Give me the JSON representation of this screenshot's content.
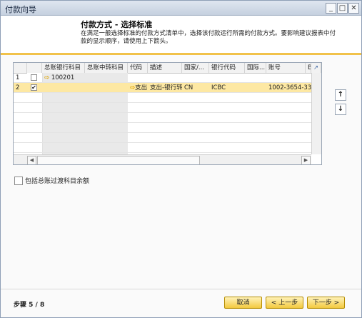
{
  "window": {
    "title": "付款向导",
    "minimize": "_",
    "maximize": "□",
    "close": "✕"
  },
  "header": {
    "title": "付款方式 - 选择标准",
    "description": "在满足一般选择标准的付款方式清单中，选择该付款运行所需的付款方式。要影响建议报表中付款的显示顺序，请使用上下箭头。"
  },
  "grid": {
    "columns": [
      "总账银行科目",
      "总账中转科目",
      "代码",
      "描述",
      "国家/...",
      "银行代码",
      "国际...",
      "账号",
      "B"
    ],
    "rows": [
      {
        "num": "1",
        "checked": false,
        "arrow": "⇨",
        "gl_account": "100201"
      },
      {
        "num": "2",
        "checked": true,
        "code_arrow": "⇨",
        "code": "支出",
        "desc": "支出-银行转账",
        "country": "CN",
        "bank_code": "ICBC",
        "account": "1002-3654-33"
      }
    ],
    "expand_icon": "↗"
  },
  "move_up_label": "↑",
  "move_down_label": "↓",
  "checkbox": {
    "label": "包括总账过渡科目余额"
  },
  "footer": {
    "step": "步骤 5 / 8",
    "cancel": "取消",
    "back": "< 上一步",
    "next": "下一步 >"
  },
  "scroll_left": "◀",
  "scroll_right": "▶",
  "check_mark": "✔"
}
